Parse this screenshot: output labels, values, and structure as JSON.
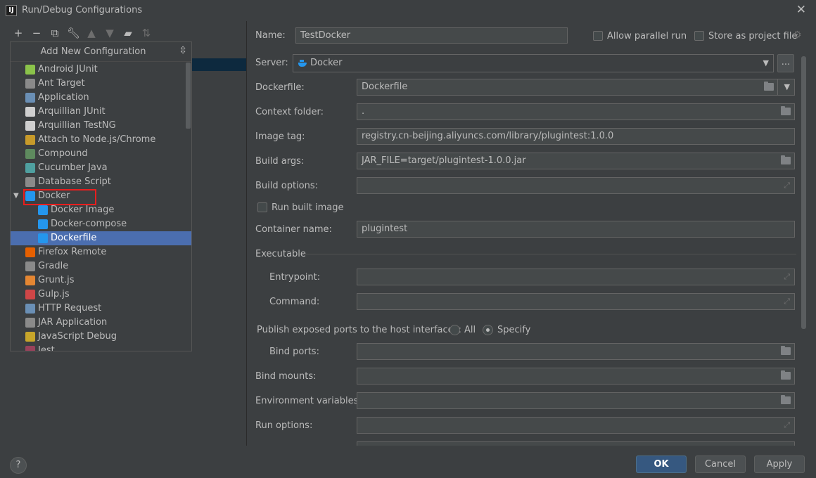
{
  "window": {
    "title": "Run/Debug Configurations"
  },
  "toolbar": {
    "icons": [
      "plus-icon",
      "minus-icon",
      "copy-icon",
      "wrench-icon",
      "arrow-up-icon",
      "arrow-down-icon",
      "folder-icon",
      "sort-icon"
    ]
  },
  "popup": {
    "title": "Add New Configuration",
    "items": [
      {
        "label": "Android JUnit",
        "icon": "android-junit-icon",
        "color": "#8bc34a",
        "indent": 0
      },
      {
        "label": "Ant Target",
        "icon": "ant-icon",
        "color": "#8a8a8a",
        "indent": 0
      },
      {
        "label": "Application",
        "icon": "application-icon",
        "color": "#6a8fb5",
        "indent": 0
      },
      {
        "label": "Arquillian JUnit",
        "icon": "arquillian-icon",
        "color": "#cfcfcf",
        "indent": 0
      },
      {
        "label": "Arquillian TestNG",
        "icon": "arquillian-icon",
        "color": "#cfcfcf",
        "indent": 0
      },
      {
        "label": "Attach to Node.js/Chrome",
        "icon": "nodejs-icon",
        "color": "#c79a2a",
        "indent": 0
      },
      {
        "label": "Compound",
        "icon": "compound-icon",
        "color": "#5e8a5e",
        "indent": 0
      },
      {
        "label": "Cucumber Java",
        "icon": "cucumber-icon",
        "color": "#4fa0a0",
        "indent": 0
      },
      {
        "label": "Database Script",
        "icon": "database-icon",
        "color": "#8a8a8a",
        "indent": 0
      },
      {
        "label": "Docker",
        "icon": "docker-icon",
        "color": "#2496ed",
        "indent": 0,
        "expandable": true,
        "arrow": "▼"
      },
      {
        "label": "Docker Image",
        "icon": "docker-icon",
        "color": "#2496ed",
        "indent": 1
      },
      {
        "label": "Docker-compose",
        "icon": "docker-icon",
        "color": "#2496ed",
        "indent": 1
      },
      {
        "label": "Dockerfile",
        "icon": "docker-icon",
        "color": "#2496ed",
        "indent": 1,
        "selected": true
      },
      {
        "label": "Firefox Remote",
        "icon": "firefox-icon",
        "color": "#e66000",
        "indent": 0
      },
      {
        "label": "Gradle",
        "icon": "gradle-icon",
        "color": "#8a8a8a",
        "indent": 0
      },
      {
        "label": "Grunt.js",
        "icon": "grunt-icon",
        "color": "#e48632",
        "indent": 0
      },
      {
        "label": "Gulp.js",
        "icon": "gulp-icon",
        "color": "#cf4647",
        "indent": 0
      },
      {
        "label": "HTTP Request",
        "icon": "http-request-icon",
        "color": "#6a8fb5",
        "indent": 0
      },
      {
        "label": "JAR Application",
        "icon": "jar-icon",
        "color": "#8a8a8a",
        "indent": 0
      },
      {
        "label": "JavaScript Debug",
        "icon": "javascript-debug-icon",
        "color": "#c7a52a",
        "indent": 0
      },
      {
        "label": "Jest",
        "icon": "jest-icon",
        "color": "#99425b",
        "indent": 0
      }
    ]
  },
  "form": {
    "name_label": "Name:",
    "name_value": "TestDocker",
    "allow_parallel_label": "Allow parallel run",
    "store_as_project_label": "Store as project file",
    "server_label": "Server:",
    "server_value": "Docker",
    "ellipsis": "...",
    "dockerfile_label": "Dockerfile:",
    "dockerfile_value": "Dockerfile",
    "context_folder_label": "Context folder:",
    "context_folder_value": ".",
    "image_tag_label": "Image tag:",
    "image_tag_value": "registry.cn-beijing.aliyuncs.com/library/plugintest:1.0.0",
    "build_args_label": "Build args:",
    "build_args_value": "JAR_FILE=target/plugintest-1.0.0.jar",
    "build_options_label": "Build options:",
    "build_options_value": "",
    "run_built_image_label": "Run built image",
    "container_name_label": "Container name:",
    "container_name_value": "plugintest",
    "executable_label": "Executable",
    "entrypoint_label": "Entrypoint:",
    "command_label": "Command:",
    "publish_ports_label": "Publish exposed ports to the host interfaces:",
    "radio_all": "All",
    "radio_specify": "Specify",
    "bind_ports_label": "Bind ports:",
    "bind_mounts_label": "Bind mounts:",
    "env_vars_label": "Environment variables:",
    "run_options_label": "Run options:"
  },
  "buttons": {
    "ok": "OK",
    "cancel": "Cancel",
    "apply": "Apply",
    "help": "?"
  },
  "colors": {
    "accent": "#4b6eaf",
    "primary_button": "#365880",
    "highlight_box": "#e81e1e",
    "background": "#3c3f41"
  }
}
